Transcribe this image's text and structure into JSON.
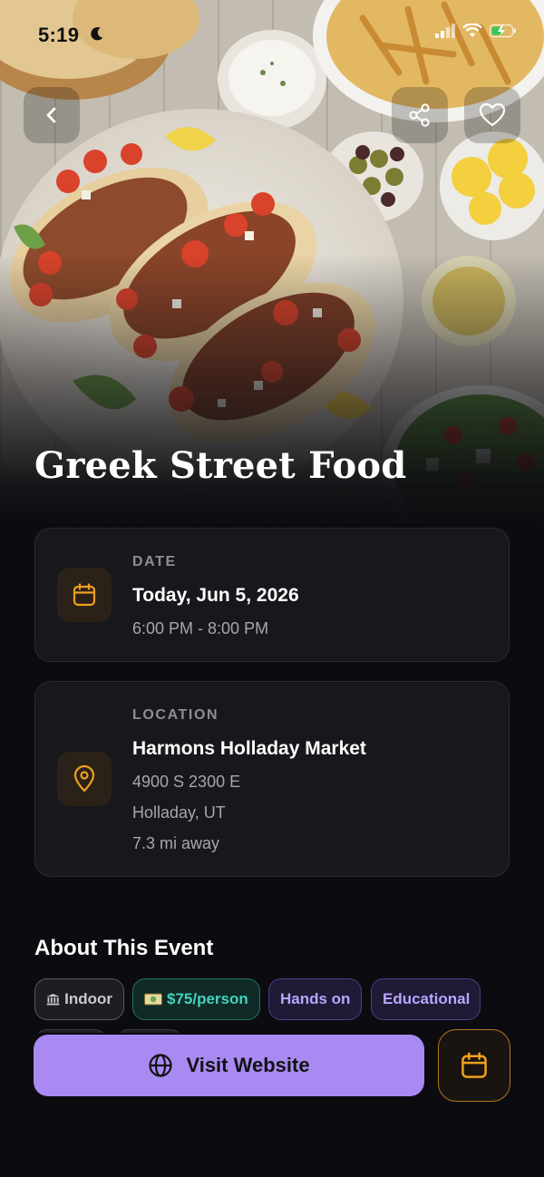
{
  "status_bar": {
    "time": "5:19"
  },
  "event": {
    "title": "Greek Street Food"
  },
  "date_card": {
    "label": "DATE",
    "date": "Today, Jun 5, 2026",
    "time_range": "6:00 PM - 8:00 PM",
    "icon": "calendar-icon"
  },
  "location_card": {
    "label": "LOCATION",
    "venue": "Harmons Holladay Market",
    "address_line1": "4900 S 2300 E",
    "address_line2": "Holladay, UT",
    "distance": "7.3 mi away",
    "icon": "map-pin-icon"
  },
  "about": {
    "heading": "About This Event",
    "tags": [
      {
        "label": "Indoor",
        "icon": "building-icon"
      },
      {
        "label": "$75/person",
        "icon": "money-icon"
      },
      {
        "label": "Hands on"
      },
      {
        "label": "Educational"
      }
    ]
  },
  "actions": {
    "visit_label": "Visit Website",
    "visit_icon": "globe-icon",
    "calendar_icon": "calendar-icon"
  },
  "colors": {
    "accent_purple": "#a98af2",
    "accent_orange": "#f0a020",
    "teal": "#43d3bd",
    "background": "#0c0c10",
    "card": "#17171c"
  }
}
